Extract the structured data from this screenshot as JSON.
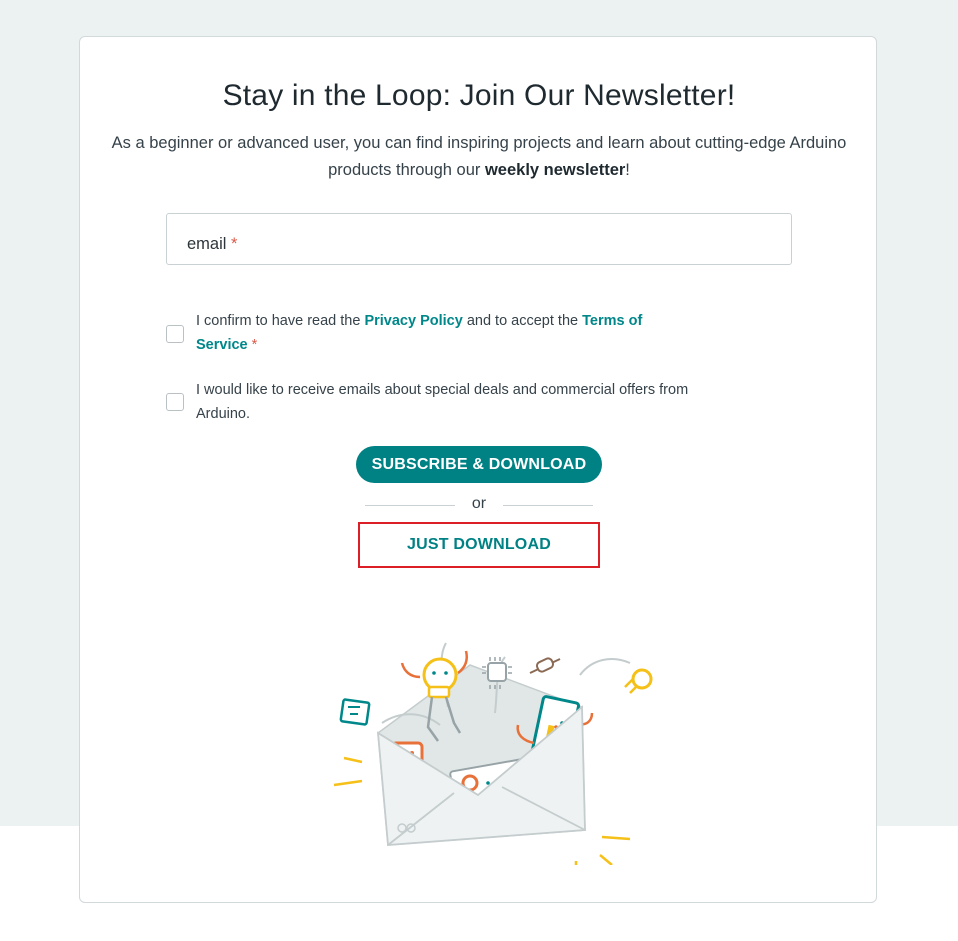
{
  "newsletter": {
    "title": "Stay in the Loop: Join Our Newsletter!",
    "subtitle_part1": "As a beginner or advanced user, you can find inspiring projects and learn about cutting-edge Arduino products through our ",
    "subtitle_bold": "weekly newsletter",
    "subtitle_end": "!"
  },
  "form": {
    "email_label": "email",
    "required_mark": "*",
    "privacy": {
      "text_before": "I confirm to have read the ",
      "privacy_link": "Privacy Policy",
      "text_middle": " and to accept the ",
      "terms_link": "Terms of Service",
      "checked": false
    },
    "offers": {
      "text": "I would like to receive emails about special deals and commercial offers from Arduino.",
      "checked": false
    },
    "subscribe_label": "SUBSCRIBE & DOWNLOAD",
    "or_label": "or",
    "download_label": "JUST DOWNLOAD"
  },
  "colors": {
    "accent": "#008184",
    "required": "#da5b4a",
    "highlight_border": "#dc1f26",
    "page_bg": "#ecf1f1"
  },
  "illustration": {
    "icon": "envelope-with-arduino-boards-icon"
  }
}
